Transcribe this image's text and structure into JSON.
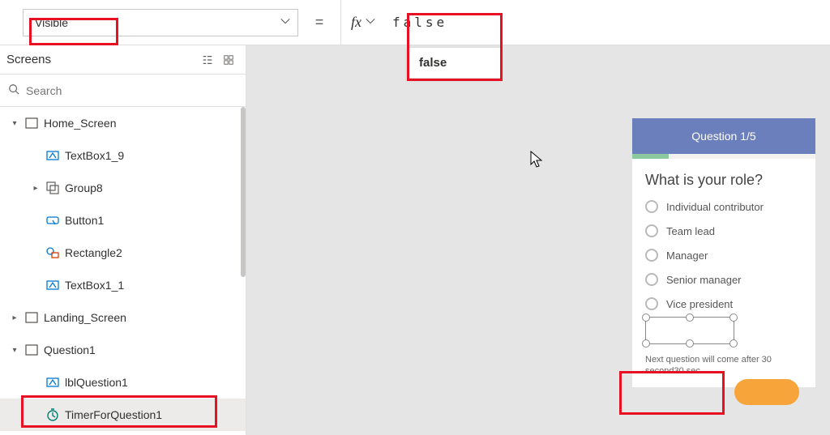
{
  "formula": {
    "property": "Visible",
    "equals": "=",
    "fx_label": "fx",
    "value": "false",
    "suggestion": "false"
  },
  "panel": {
    "title": "Screens",
    "search_placeholder": "Search"
  },
  "tree": {
    "home_screen": "Home_Screen",
    "textbox1_9": "TextBox1_9",
    "group8": "Group8",
    "button1": "Button1",
    "rectangle2": "Rectangle2",
    "textbox1_1": "TextBox1_1",
    "landing_screen": "Landing_Screen",
    "question1": "Question1",
    "lblquestion1": "lblQuestion1",
    "timer": "TimerForQuestion1"
  },
  "preview": {
    "title": "Question 1/5",
    "question": "What is your role?",
    "options": [
      "Individual contributor",
      "Team lead",
      "Manager",
      "Senior manager",
      "Vice president"
    ],
    "hint": "Next question will come after 30 second30 sec"
  }
}
